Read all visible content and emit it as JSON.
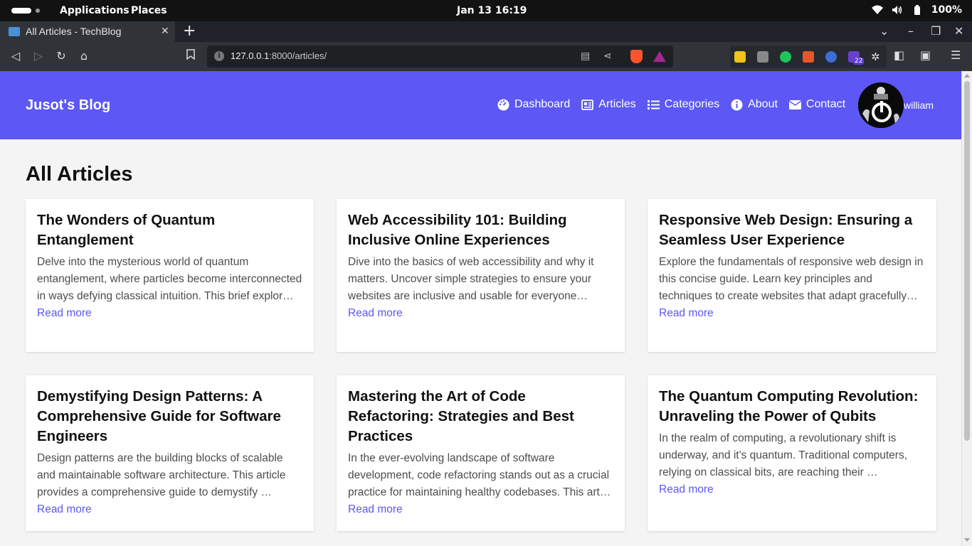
{
  "os": {
    "activities": "Applications",
    "places": "Places",
    "clock": "Jan 13  16:19",
    "battery": "100%"
  },
  "browser": {
    "tab_title": "All Articles - TechBlog",
    "url_host": "127.0.0.1",
    "url_path": ":8000/articles/",
    "ext_badge": "22"
  },
  "site": {
    "brand": "Jusot's Blog",
    "nav": [
      {
        "label": "Dashboard",
        "icon": "dashboard-icon"
      },
      {
        "label": "Articles",
        "icon": "newspaper-icon"
      },
      {
        "label": "Categories",
        "icon": "list-icon"
      },
      {
        "label": "About",
        "icon": "info-icon"
      },
      {
        "label": "Contact",
        "icon": "envelope-icon"
      }
    ],
    "username": "william"
  },
  "main": {
    "title": "All Articles",
    "articles": [
      {
        "title": "The Wonders of Quantum Entanglement",
        "excerpt": "Delve into the mysterious world of quantum entanglement, where particles become interconnected in ways defying classical intuition. This brief explor…",
        "link": "Read more"
      },
      {
        "title": "Web Accessibility 101: Building Inclusive Online Experiences",
        "excerpt": "Dive into the basics of web accessibility and why it matters. Uncover simple strategies to ensure your websites are inclusive and usable for everyone…",
        "link": "Read more"
      },
      {
        "title": "Responsive Web Design: Ensuring a Seamless User Experience",
        "excerpt": "Explore the fundamentals of responsive web design in this concise guide. Learn key principles and techniques to create websites that adapt gracefully…",
        "link": "Read more"
      },
      {
        "title": "Demystifying Design Patterns: A Comprehensive Guide for Software Engineers",
        "excerpt": "Design patterns are the building blocks of scalable and maintainable software architecture. This article provides a comprehensive guide to demystify …",
        "link": "Read more"
      },
      {
        "title": "Mastering the Art of Code Refactoring: Strategies and Best Practices",
        "excerpt": "In the ever-evolving landscape of software development, code refactoring stands out as a crucial practice for maintaining healthy codebases. This art…",
        "link": "Read more"
      },
      {
        "title": "The Quantum Computing Revolution: Unraveling the Power of Qubits",
        "excerpt": "In the realm of computing, a revolutionary shift is underway, and it's quantum. Traditional computers, relying on classical bits, are reaching their …",
        "link": "Read more"
      }
    ]
  },
  "colors": {
    "brand": "#5c57f5",
    "card_bg": "#ffffff",
    "page_bg": "#f4f4f5"
  }
}
